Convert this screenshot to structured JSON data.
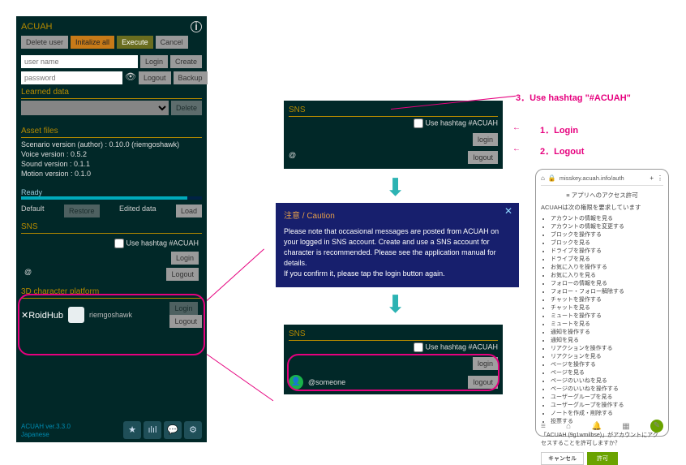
{
  "main": {
    "title": "ACUAH",
    "buttons": {
      "delete_user": "Delete user",
      "initialize": "Initalize all",
      "execute": "Execute",
      "cancel": "Cancel",
      "login": "Login",
      "create": "Create",
      "logout": "Logout",
      "backup": "Backup",
      "delete": "Delete",
      "restore": "Restore",
      "load": "Load"
    },
    "placeholders": {
      "user": "user name",
      "pass": "password"
    },
    "learned_label": "Learned data",
    "asset_label": "Asset files",
    "assets": [
      "Scenario version (author) : 0.10.0 (riemgoshawk)",
      "Voice version : 0.5.2",
      "Sound version : 0.1.1",
      "Motion version : 0.1.0"
    ],
    "ready": "Ready",
    "default": "Default",
    "edited": "Edited data",
    "sns_label": "SNS",
    "hashtag": "Use hashtag #ACUAH",
    "mention": "@",
    "platform_label": "3D character platform",
    "vroid": {
      "logo": "✕RoidHub",
      "user": "riemgoshawk"
    },
    "footer": {
      "ver": "ACUAH ver.3.3.0",
      "lang": "Japanese"
    }
  },
  "sns_top": {
    "label": "SNS",
    "hashtag": "Use hashtag #ACUAH",
    "login": "login",
    "mention": "@",
    "logout": "logout"
  },
  "caution": {
    "header": "注意 / Caution",
    "body": "Please note that occasional messages are posted from ACUAH on your logged in SNS account. Create and use a SNS account for character is recommended. Please see the application manual for details.\nIf you confirm it, please tap the login button again."
  },
  "sns_bottom": {
    "label": "SNS",
    "hashtag": "Use hashtag #ACUAH",
    "login": "login",
    "handle": "@someone",
    "logout": "logout"
  },
  "callouts": {
    "c1": "1．Login",
    "c2": "2．Logout",
    "c3": "3．Use hashtag \"#ACUAH\""
  },
  "mobile": {
    "url": "misskey.acuah.info/auth",
    "perm_title": "アプリへのアクセス許可",
    "app_request": "ACUAHは次の権限を要求しています",
    "scopes": [
      "アカウントの情報を見る",
      "アカウントの情報を変更する",
      "ブロックを操作する",
      "ブロックを見る",
      "ドライブを操作する",
      "ドライブを見る",
      "お気に入りを操作する",
      "お気に入りを見る",
      "フォローの情報を見る",
      "フォロー・フォロー解除する",
      "チャットを操作する",
      "チャットを見る",
      "ミュートを操作する",
      "ミュートを見る",
      "通知を操作する",
      "通知を見る",
      "リアクションを操作する",
      "リアクションを見る",
      "ページを操作する",
      "ページを見る",
      "ページのいいねを見る",
      "ページのいいねを操作する",
      "ユーザーグループを見る",
      "ユーザーグループを操作する",
      "ノートを作成・削除する",
      "投票する"
    ],
    "confirm": "「ACUAH (9g1wmilbse)」がアカウントにアクセスすることを許可しますか？",
    "cancel": "キャンセル",
    "ok": "許可"
  }
}
